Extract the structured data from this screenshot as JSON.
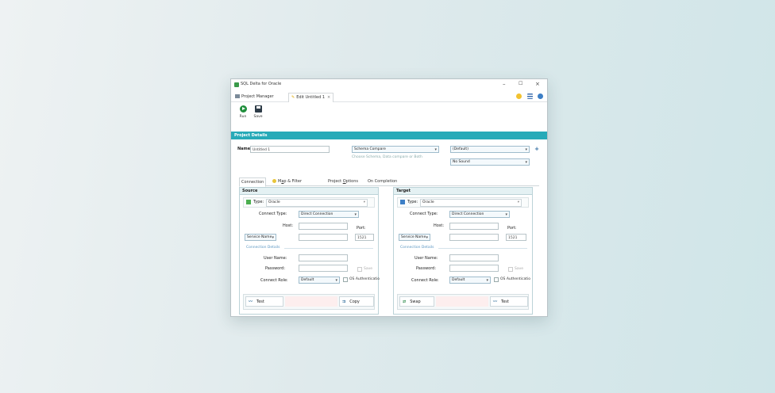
{
  "window": {
    "title": "SQL Delta for Oracle",
    "controls": {
      "minimize": "–",
      "maximize": "☐",
      "close": "×"
    }
  },
  "tabs": {
    "project_manager": "Project Manager",
    "edit": "Edit Untitled 1",
    "close_glyph": "×"
  },
  "toolbar": {
    "run_label": "Run",
    "save_label": "Save"
  },
  "project_details": {
    "header": "Project Details",
    "name_label": "Name:",
    "name_value": "Untitled 1",
    "compare_type": "Schema Compare",
    "compare_hint": "Choose Schema, Data compare or Both",
    "profile": "(Default)",
    "sound": "No Sound",
    "add_glyph": "+"
  },
  "panel_tabs": {
    "connection": "Connection",
    "map_filter_prefix": "M",
    "map_filter_ul": "a",
    "map_filter_rest": "p & Filter",
    "project_options_prefix": "Project ",
    "project_options_ul": "O",
    "project_options_rest": "ptions",
    "on_completion": "On Completion"
  },
  "source": {
    "header": "Source",
    "type_label": "Type:",
    "type_value": "Oracle",
    "connect_type_label": "Connect Type:",
    "connect_type_value": "Direct Connection",
    "host_label": "Host:",
    "host_value": "",
    "port_label": "Port:",
    "service_select": "Service Name",
    "service_value": "",
    "port_value": "1521",
    "connection_details": "Connection Details",
    "user_label": "User Name:",
    "user_value": "",
    "password_label": "Password:",
    "password_value": "",
    "save_label": "Save",
    "connect_role_label": "Connect Role:",
    "connect_role_value": "Default",
    "os_auth_label": "OS Authenticatio",
    "test_label": "Test",
    "copy_label": "Copy",
    "test_icon": "〰",
    "copy_icon": "⇉"
  },
  "target": {
    "header": "Target",
    "type_label": "Type:",
    "type_value": "Oracle",
    "connect_type_label": "Connect Type:",
    "connect_type_value": "Direct Connection",
    "host_label": "Host:",
    "host_value": "",
    "port_label": "Port:",
    "service_select": "Service Name",
    "service_value": "",
    "port_value": "1521",
    "connection_details": "Connection Details",
    "user_label": "User Name:",
    "user_value": "",
    "password_label": "Password:",
    "password_value": "",
    "save_label": "Save",
    "connect_role_label": "Connect Role:",
    "connect_role_value": "Default",
    "os_auth_label": "OS Authenticatio",
    "swap_label": "Swap",
    "test_label": "Test",
    "swap_icon": "⇄",
    "test_icon": "〰"
  },
  "colors": {
    "accent": "#27aab8",
    "run": "#1f8e3c",
    "link": "#5a96c2"
  }
}
